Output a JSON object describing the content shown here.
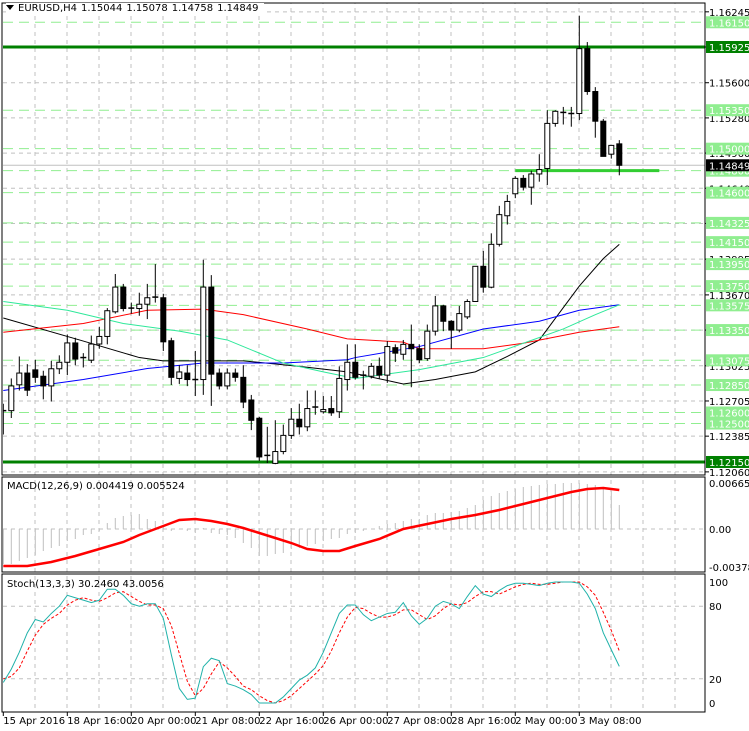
{
  "header": {
    "symbol": "EURUSD,H4",
    "open": "1.15044",
    "high": "1.15078",
    "low": "1.14758",
    "close": "1.14849",
    "menu_icon": "triangle-down-icon"
  },
  "macd_label": "MACD(12,26,9) 0.004419 0.005524",
  "stoch_label": "Stoch(13,3,3) 30.2460 43.0056",
  "colors": {
    "bull_body": "#ffffff",
    "bear_body": "#000000",
    "ma_black": "#000000",
    "ma_red": "#ff0000",
    "ma_blue": "#0000ff",
    "ma_green": "#2ee89a",
    "level_light": "#90ee90",
    "level_dark": "#008000",
    "support_segment": "#32cd32",
    "grid": "#c0c0c0",
    "macd_hist": "#c0c0c0",
    "macd_signal": "#ff0000",
    "stoch_main": "#20b2aa",
    "stoch_signal": "#ff0000"
  },
  "chart_data": [
    {
      "type": "candlestick",
      "title": "EURUSD,H4",
      "ohlc": [
        [
          1.12617,
          1.1268,
          1.124,
          1.12617
        ],
        [
          1.12617,
          1.1291,
          1.1255,
          1.12842
        ],
        [
          1.12852,
          1.1311,
          1.128,
          1.12959
        ],
        [
          1.12959,
          1.1304,
          1.1275,
          1.12803
        ],
        [
          1.12988,
          1.1308,
          1.1287,
          1.1292
        ],
        [
          1.1293,
          1.1298,
          1.1272,
          1.12842
        ],
        [
          1.12842,
          1.1307,
          1.127,
          1.12998
        ],
        [
          1.12998,
          1.1312,
          1.1295,
          1.13057
        ],
        [
          1.13057,
          1.1331,
          1.1294,
          1.13233
        ],
        [
          1.13233,
          1.1328,
          1.1303,
          1.13086
        ],
        [
          1.131,
          1.1314,
          1.1301,
          1.1309
        ],
        [
          1.13076,
          1.133,
          1.1305,
          1.13223
        ],
        [
          1.13223,
          1.1338,
          1.1318,
          1.13292
        ],
        [
          1.13292,
          1.1355,
          1.1322,
          1.13526
        ],
        [
          1.13516,
          1.1386,
          1.135,
          1.13741
        ],
        [
          1.13741,
          1.1377,
          1.1352,
          1.13546
        ],
        [
          1.1355,
          1.136,
          1.135,
          1.1354
        ],
        [
          1.13546,
          1.1369,
          1.1348,
          1.13585
        ],
        [
          1.13585,
          1.1377,
          1.1345,
          1.13644
        ],
        [
          1.1364,
          1.1395,
          1.136,
          1.1365
        ],
        [
          1.13644,
          1.1368,
          1.1316,
          1.13243
        ],
        [
          1.13253,
          1.1328,
          1.1285,
          1.1292
        ],
        [
          1.1291,
          1.1303,
          1.1286,
          1.12969
        ],
        [
          1.12959,
          1.1303,
          1.1284,
          1.129
        ],
        [
          1.129,
          1.1316,
          1.1275,
          1.129
        ],
        [
          1.129,
          1.1399,
          1.1276,
          1.13741
        ],
        [
          1.13741,
          1.1385,
          1.1266,
          1.12949
        ],
        [
          1.12959,
          1.13,
          1.1281,
          1.12842
        ],
        [
          1.12842,
          1.13,
          1.1281,
          1.12959
        ],
        [
          1.12959,
          1.13,
          1.1288,
          1.1292
        ],
        [
          1.1292,
          1.1303,
          1.1264,
          1.12695
        ],
        [
          1.12714,
          1.1276,
          1.1244,
          1.12529
        ],
        [
          1.12548,
          1.1256,
          1.1216,
          1.12196
        ],
        [
          1.1221,
          1.1247,
          1.1214,
          1.122
        ],
        [
          1.12137,
          1.1253,
          1.1213,
          1.12245
        ],
        [
          1.12245,
          1.1249,
          1.1222,
          1.12392
        ],
        [
          1.12392,
          1.1264,
          1.1236,
          1.12539
        ],
        [
          1.12539,
          1.1268,
          1.124,
          1.1247
        ],
        [
          1.1247,
          1.128,
          1.1243,
          1.12636
        ],
        [
          1.1264,
          1.128,
          1.1258,
          1.1265
        ],
        [
          1.12607,
          1.1275,
          1.1259,
          1.12627
        ],
        [
          1.12636,
          1.1275,
          1.1257,
          1.12597
        ],
        [
          1.12607,
          1.1302,
          1.1255,
          1.1291
        ],
        [
          1.129,
          1.1322,
          1.128,
          1.13057
        ],
        [
          1.13057,
          1.1322,
          1.129,
          1.1292
        ],
        [
          1.1294,
          1.1298,
          1.1281,
          1.1294
        ],
        [
          1.1293,
          1.1305,
          1.1291,
          1.1302
        ],
        [
          1.1302,
          1.131,
          1.1291,
          1.1294
        ],
        [
          1.1294,
          1.1325,
          1.1287,
          1.132
        ],
        [
          1.1319,
          1.1322,
          1.1306,
          1.1314
        ],
        [
          1.1313,
          1.1326,
          1.1308,
          1.1322
        ],
        [
          1.1322,
          1.134,
          1.1283,
          1.1318
        ],
        [
          1.1318,
          1.1322,
          1.1305,
          1.1308
        ],
        [
          1.1309,
          1.134,
          1.1307,
          1.1334
        ],
        [
          1.1334,
          1.1366,
          1.133,
          1.1357
        ],
        [
          1.1357,
          1.1358,
          1.1334,
          1.1343
        ],
        [
          1.1343,
          1.1344,
          1.1318,
          1.1335
        ],
        [
          1.1335,
          1.1357,
          1.1333,
          1.135
        ],
        [
          1.1347,
          1.1363,
          1.1345,
          1.1361
        ],
        [
          1.1361,
          1.1393,
          1.1361,
          1.1393
        ],
        [
          1.1393,
          1.1407,
          1.1369,
          1.1374
        ],
        [
          1.1374,
          1.1423,
          1.1373,
          1.1413
        ],
        [
          1.1413,
          1.1448,
          1.1411,
          1.144
        ],
        [
          1.1439,
          1.1458,
          1.1431,
          1.1452
        ],
        [
          1.1459,
          1.1475,
          1.1455,
          1.1473
        ],
        [
          1.1473,
          1.1476,
          1.1462,
          1.1465
        ],
        [
          1.1465,
          1.148,
          1.1449,
          1.1477
        ],
        [
          1.1477,
          1.1495,
          1.147,
          1.1481
        ],
        [
          1.1482,
          1.1535,
          1.1467,
          1.1523
        ],
        [
          1.1523,
          1.1535,
          1.152,
          1.1534
        ],
        [
          1.1533,
          1.1538,
          1.1522,
          1.1533
        ],
        [
          1.1532,
          1.1538,
          1.152,
          1.1532
        ],
        [
          1.1532,
          1.1621,
          1.1526,
          1.1591
        ],
        [
          1.1591,
          1.1597,
          1.1549,
          1.1552
        ],
        [
          1.1552,
          1.1556,
          1.151,
          1.1525
        ],
        [
          1.1525,
          1.1527,
          1.1493,
          1.1493
        ],
        [
          1.1495,
          1.1503,
          1.1491,
          1.1503
        ],
        [
          1.15044,
          1.15078,
          1.14758,
          1.14849
        ]
      ],
      "moving_averages": [
        {
          "color_key": "ma_black",
          "points": [
            [
              0,
              1.1346
            ],
            [
              10,
              1.1325
            ],
            [
              17,
              1.131
            ],
            [
              20,
              1.1307
            ],
            [
              30,
              1.1307
            ],
            [
              37,
              1.1302
            ],
            [
              43,
              1.1297
            ],
            [
              50,
              1.1286
            ],
            [
              54,
              1.129
            ],
            [
              59,
              1.1297
            ],
            [
              63,
              1.1311
            ],
            [
              67,
              1.1326
            ],
            [
              72,
              1.1375
            ],
            [
              75,
              1.14
            ],
            [
              77,
              1.1413
            ]
          ]
        },
        {
          "color_key": "ma_red",
          "points": [
            [
              0,
              1.1333
            ],
            [
              10,
              1.1341
            ],
            [
              18,
              1.1353
            ],
            [
              25,
              1.1354
            ],
            [
              30,
              1.1349
            ],
            [
              38,
              1.1336
            ],
            [
              43,
              1.1327
            ],
            [
              50,
              1.1324
            ],
            [
              52,
              1.1318
            ],
            [
              60,
              1.1318
            ],
            [
              65,
              1.1323
            ],
            [
              72,
              1.1333
            ],
            [
              77,
              1.1338
            ]
          ]
        },
        {
          "color_key": "ma_blue",
          "points": [
            [
              0,
              1.128
            ],
            [
              10,
              1.129
            ],
            [
              18,
              1.13
            ],
            [
              25,
              1.1305
            ],
            [
              35,
              1.1305
            ],
            [
              43,
              1.1308
            ],
            [
              44,
              1.131
            ],
            [
              52,
              1.132
            ],
            [
              60,
              1.1336
            ],
            [
              67,
              1.1343
            ],
            [
              72,
              1.1353
            ],
            [
              77,
              1.1358
            ]
          ]
        },
        {
          "color_key": "ma_green",
          "points": [
            [
              0,
              1.1361
            ],
            [
              8,
              1.1353
            ],
            [
              15,
              1.1341
            ],
            [
              22,
              1.1334
            ],
            [
              28,
              1.1326
            ],
            [
              35,
              1.1305
            ],
            [
              40,
              1.1297
            ],
            [
              44,
              1.1291
            ],
            [
              52,
              1.1299
            ],
            [
              60,
              1.131
            ],
            [
              65,
              1.1323
            ],
            [
              70,
              1.1336
            ],
            [
              74,
              1.1349
            ],
            [
              77,
              1.1358
            ]
          ]
        }
      ],
      "price_ticks": [
        "1.16245",
        "1.15925",
        "1.15600",
        "1.15280",
        "1.14960",
        "1.14640",
        "1.14320",
        "1.13995",
        "1.13670",
        "1.13350",
        "1.13025",
        "1.12705",
        "1.12385",
        "1.12060"
      ],
      "light_levels": [
        "1.16150",
        "1.15350",
        "1.15000",
        "1.14800",
        "1.14600",
        "1.14325",
        "1.14150",
        "1.13950",
        "1.13750",
        "1.13575",
        "1.13350",
        "1.13075",
        "1.12850",
        "1.12600",
        "1.12500"
      ],
      "dark_levels": [
        "1.15925",
        "1.12150"
      ],
      "support_segment": {
        "price": 1.148,
        "from_index": 64,
        "to_index": 82
      },
      "current_price": "1.14849",
      "time_labels": [
        {
          "index": 0,
          "label": "15 Apr 2016"
        },
        {
          "index": 8,
          "label": "18 Apr 16:00"
        },
        {
          "index": 16,
          "label": "20 Apr 00:00"
        },
        {
          "index": 24,
          "label": "21 Apr 08:00"
        },
        {
          "index": 32,
          "label": "22 Apr 16:00"
        },
        {
          "index": 40,
          "label": "26 Apr 00:00"
        },
        {
          "index": 48,
          "label": "27 Apr 08:00"
        },
        {
          "index": 56,
          "label": "28 Apr 16:00"
        },
        {
          "index": 64,
          "label": "2 May 00:00"
        },
        {
          "index": 72,
          "label": "3 May 08:00"
        }
      ]
    },
    {
      "type": "bar",
      "title": "MACD(12,26,9)",
      "histogram": [
        -0.0035,
        -0.0035,
        -0.0032,
        -0.0029,
        -0.0026,
        -0.0022,
        -0.0019,
        -0.0017,
        -0.0012,
        -0.001,
        -0.0006,
        -0.0005,
        -0.0002,
        0.0006,
        0.0011,
        0.0013,
        0.0014,
        0.0015,
        0.001,
        0.0008,
        0.0003,
        -0.0002,
        -3e-05,
        -0.0002,
        -0.0004,
        0.0001,
        -0.0004,
        -0.0005,
        -0.0006,
        -0.0009,
        -0.0014,
        -0.0019,
        -0.0027,
        -0.0027,
        -0.0025,
        -0.0024,
        -0.002,
        -0.0019,
        -0.0017,
        -0.0015,
        -0.0012,
        -0.001,
        -0.0009,
        -0.0005,
        -0.0004,
        -0.0002,
        0.0,
        0.0003,
        0.0005,
        0.0006,
        0.0008,
        0.001,
        0.001,
        0.0014,
        0.0016,
        0.0016,
        0.0017,
        0.0018,
        0.0021,
        0.0024,
        0.0029,
        0.0033,
        0.0036,
        0.0038,
        0.004,
        0.0042,
        0.0043,
        0.0044,
        0.0045,
        0.0045,
        0.0046,
        0.0046,
        0.0046,
        0.0045,
        0.0044,
        0.0042,
        0.0038,
        0.0024
      ],
      "signal": [
        [
          0,
          -0.0037
        ],
        [
          3,
          -0.0037
        ],
        [
          6,
          -0.0033
        ],
        [
          9,
          -0.0027
        ],
        [
          12,
          -0.002
        ],
        [
          15,
          -0.0013
        ],
        [
          17,
          -0.0006
        ],
        [
          19,
          0.0
        ],
        [
          21,
          0.0006
        ],
        [
          22,
          0.0009
        ],
        [
          24,
          0.001
        ],
        [
          26,
          0.0008
        ],
        [
          28,
          0.0005
        ],
        [
          30,
          0.0001
        ],
        [
          32,
          -0.0004
        ],
        [
          34,
          -0.0009
        ],
        [
          36,
          -0.0014
        ],
        [
          38,
          -0.002
        ],
        [
          40,
          -0.0022
        ],
        [
          42,
          -0.0022
        ],
        [
          44,
          -0.0017
        ],
        [
          47,
          -0.001
        ],
        [
          50,
          0.0
        ],
        [
          53,
          0.0005
        ],
        [
          56,
          0.001
        ],
        [
          59,
          0.0014
        ],
        [
          62,
          0.0019
        ],
        [
          65,
          0.0025
        ],
        [
          68,
          0.0031
        ],
        [
          71,
          0.0037
        ],
        [
          73,
          0.004
        ],
        [
          75,
          0.0041
        ],
        [
          77,
          0.0039
        ]
      ],
      "axis_labels": {
        "top": "0.006657",
        "zero": "0.00",
        "bottom": "-0.003788"
      }
    },
    {
      "type": "line",
      "title": "Stoch(13,3,3)",
      "ylim": [
        0,
        100
      ],
      "main": [
        17,
        28,
        42,
        58,
        69,
        67,
        74,
        80,
        89,
        87,
        85,
        83,
        85,
        94,
        94,
        89,
        82,
        80,
        82,
        82,
        70,
        40,
        12,
        3,
        4,
        30,
        37,
        35,
        16,
        14,
        11,
        7,
        0,
        0,
        0,
        5,
        12,
        19,
        23,
        29,
        42,
        58,
        74,
        81,
        81,
        73,
        68,
        71,
        74,
        75,
        83,
        72,
        65,
        70,
        80,
        84,
        82,
        78,
        88,
        97,
        90,
        88,
        93,
        97,
        99,
        99,
        98,
        97,
        99,
        100,
        100,
        100,
        99,
        90,
        78,
        58,
        44,
        30.246
      ],
      "signal": [
        20,
        22,
        29,
        43,
        56,
        65,
        70,
        74,
        81,
        85,
        87,
        85,
        84,
        87,
        91,
        92,
        88,
        84,
        81,
        81,
        78,
        64,
        41,
        18,
        6,
        12,
        24,
        34,
        29,
        22,
        14,
        11,
        6,
        2,
        0,
        2,
        6,
        12,
        18,
        24,
        31,
        43,
        58,
        71,
        79,
        78,
        74,
        71,
        71,
        73,
        77,
        77,
        73,
        69,
        72,
        78,
        82,
        81,
        83,
        88,
        92,
        92,
        90,
        93,
        96,
        98,
        99,
        98,
        98,
        99,
        100,
        100,
        100,
        96,
        89,
        75,
        60,
        43.0056
      ],
      "axis_labels": [
        "100",
        "80",
        "20",
        "0"
      ],
      "levels": [
        80,
        20
      ]
    }
  ]
}
